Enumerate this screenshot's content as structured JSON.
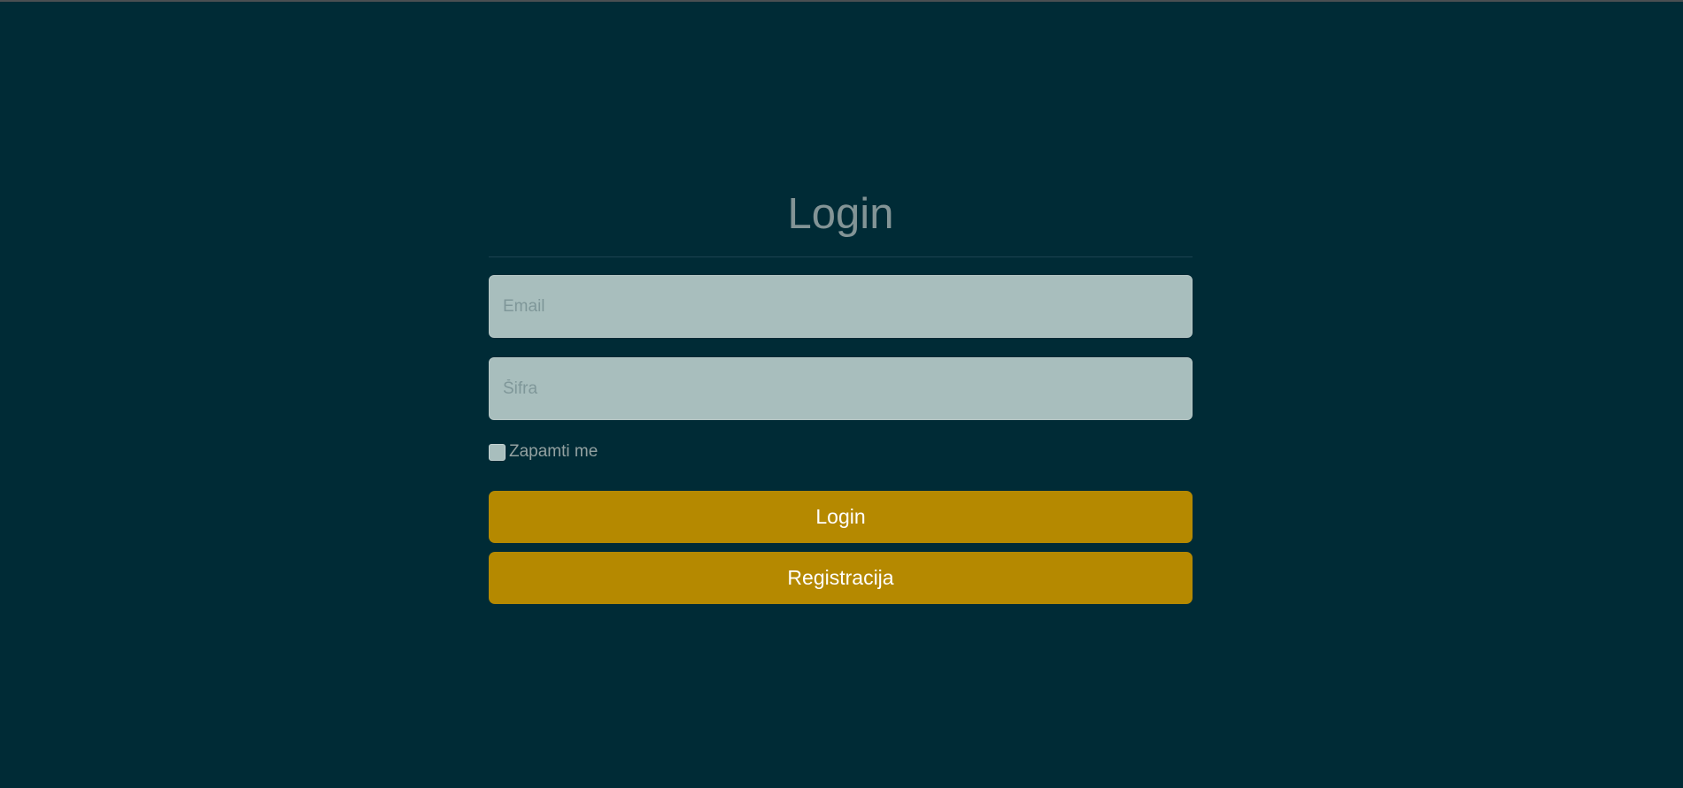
{
  "login": {
    "title": "Login",
    "email": {
      "placeholder": "Email",
      "value": ""
    },
    "password": {
      "placeholder": "Šifra",
      "value": ""
    },
    "remember_label": "Zapamti me",
    "remember_checked": false,
    "login_button": "Login",
    "register_button": "Registracija"
  },
  "colors": {
    "background": "#002b36",
    "field": "#a8bebd",
    "accent": "#b58900",
    "title": "#839496"
  }
}
